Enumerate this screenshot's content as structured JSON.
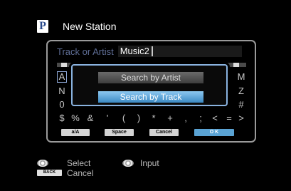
{
  "header": {
    "logo_letter": "P",
    "title": "New Station"
  },
  "input": {
    "label": "Track or Artist",
    "value": "Music2"
  },
  "keyboard": {
    "left_column": [
      "A",
      "N",
      "0",
      "$"
    ],
    "right_column": [
      "M",
      "Z",
      "#",
      ">"
    ],
    "bottom_row": [
      "%",
      "&",
      "'",
      "(",
      ")",
      "*",
      "+",
      ",",
      ";",
      "<",
      "="
    ]
  },
  "function_buttons": {
    "case": "a/A",
    "space": "Space",
    "cancel": "Cancel",
    "ok": "O K"
  },
  "popup": {
    "option_artist": "Search by Artist",
    "option_track": "Search by Track"
  },
  "footer": {
    "select_label": "Select",
    "input_label": "Input",
    "back_badge": "BACK",
    "cancel_label": "Cancel"
  }
}
